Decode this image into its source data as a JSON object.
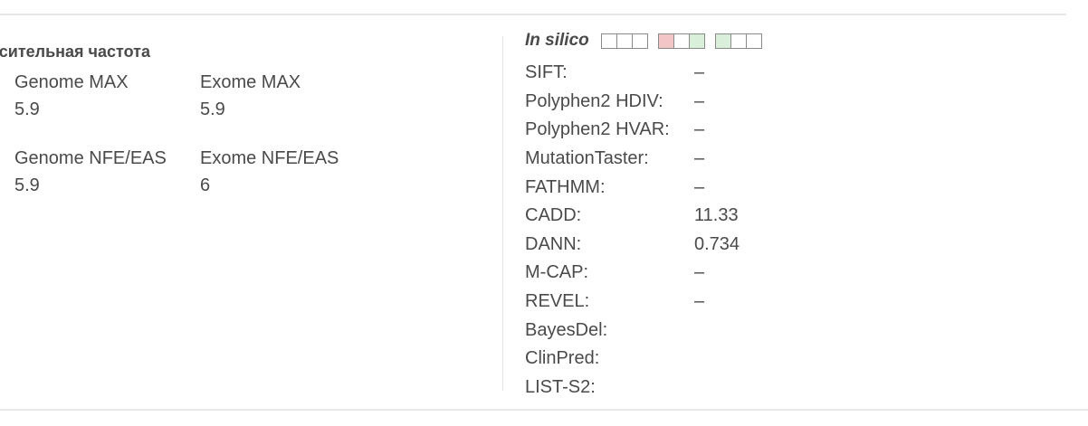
{
  "frequency": {
    "title": "осительная частота",
    "cells": [
      {
        "label": "Genome MAX",
        "value": "5.9"
      },
      {
        "label": "Exome MAX",
        "value": "5.9"
      },
      {
        "label": "Genome NFE/EAS",
        "value": "5.9"
      },
      {
        "label": "Exome NFE/EAS",
        "value": "6"
      }
    ]
  },
  "insilico": {
    "title": "In silico",
    "box_groups": [
      [
        "empty",
        "empty",
        "empty"
      ],
      [
        "red",
        "empty",
        "green"
      ],
      [
        "green",
        "empty",
        "empty"
      ]
    ],
    "colors": {
      "red_box": "#f2c6c6",
      "green_box": "#d9efd9",
      "box_border": "#8a8a8a"
    },
    "scores": [
      {
        "name": "SIFT:",
        "value": "–"
      },
      {
        "name": "Polyphen2 HDIV:",
        "value": "–"
      },
      {
        "name": "Polyphen2 HVAR:",
        "value": "–"
      },
      {
        "name": "MutationTaster:",
        "value": "–"
      },
      {
        "name": "FATHMM:",
        "value": "–"
      },
      {
        "name": "CADD:",
        "value": "11.33"
      },
      {
        "name": "DANN:",
        "value": "0.734"
      },
      {
        "name": "M-CAP:",
        "value": "–"
      },
      {
        "name": "REVEL:",
        "value": "–"
      },
      {
        "name": "BayesDel:",
        "value": ""
      },
      {
        "name": "ClinPred:",
        "value": ""
      },
      {
        "name": "LIST-S2:",
        "value": ""
      }
    ]
  }
}
